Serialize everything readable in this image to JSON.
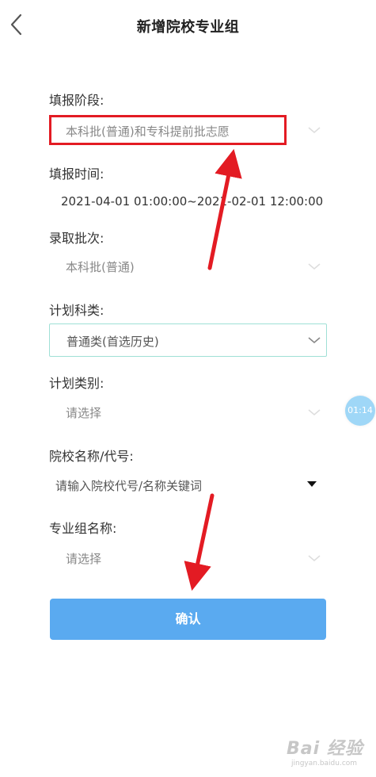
{
  "header": {
    "title": "新增院校专业组"
  },
  "form": {
    "stage": {
      "label": "填报阶段:",
      "value": "本科批(普通)和专科提前批志愿"
    },
    "time": {
      "label": "填报时间:",
      "value": "2021-04-01 01:00:00~2021-02-01 12:00:00"
    },
    "batch": {
      "label": "录取批次:",
      "value": "本科批(普通)"
    },
    "subject": {
      "label": "计划科类:",
      "value": "普通类(首选历史)"
    },
    "category": {
      "label": "计划类别:",
      "value": "请选择"
    },
    "school": {
      "label": "院校名称/代号:",
      "placeholder": "请输入院校代号/名称关键词"
    },
    "group": {
      "label": "专业组名称:",
      "value": "请选择"
    }
  },
  "actions": {
    "confirm_label": "确认"
  },
  "timer_badge": "01:14",
  "watermark": {
    "main": "Bai 经验",
    "sub": "jingyan.baidu.com"
  },
  "colors": {
    "accent_button": "#5aaaf0",
    "annotation_red": "#e31b23",
    "outline_teal": "#9fe0d6",
    "timer_badge": "#9fd7f7"
  }
}
